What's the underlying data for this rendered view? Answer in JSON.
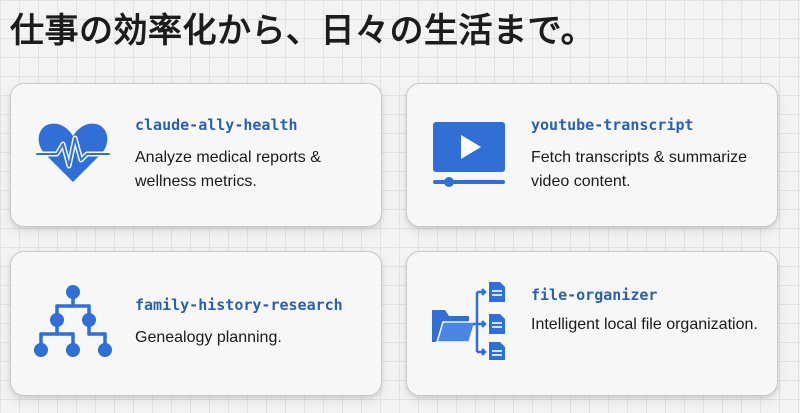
{
  "headline": "仕事の効率化から、日々の生活まで。",
  "accent_color": "#2f6fd6",
  "cards": [
    {
      "icon": "heart-pulse-icon",
      "title": "claude-ally-health",
      "description": "Analyze medical reports & wellness metrics."
    },
    {
      "icon": "video-player-icon",
      "title": "youtube-transcript",
      "description": "Fetch transcripts & summarize video content."
    },
    {
      "icon": "family-tree-icon",
      "title": "family-history-research",
      "description": "Genealogy planning."
    },
    {
      "icon": "folder-files-icon",
      "title": "file-organizer",
      "description": "Intelligent local file organization."
    }
  ]
}
